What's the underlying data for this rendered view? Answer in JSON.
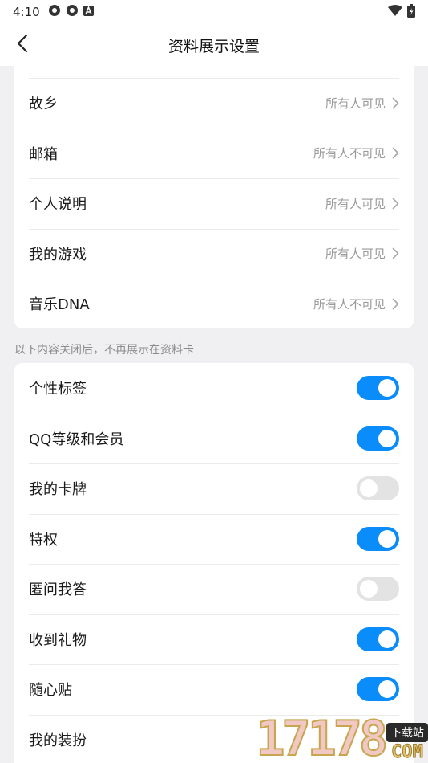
{
  "status_bar": {
    "time": "4:10",
    "icons_left": [
      "settings-gear-icon",
      "settings-gear-icon",
      "a-badge-icon"
    ],
    "icons_right": [
      "wifi-icon",
      "battery-icon"
    ]
  },
  "app_bar": {
    "title": "资料展示设置",
    "back_icon": "chevron-left-icon"
  },
  "visibility_settings": [
    {
      "label": "故乡",
      "value": "所有人可见"
    },
    {
      "label": "邮箱",
      "value": "所有人不可见"
    },
    {
      "label": "个人说明",
      "value": "所有人可见"
    },
    {
      "label": "我的游戏",
      "value": "所有人可见"
    },
    {
      "label": "音乐DNA",
      "value": "所有人不可见"
    }
  ],
  "section_hint": "以下内容关闭后，不再展示在资料卡",
  "toggle_settings": [
    {
      "label": "个性标签",
      "on": true
    },
    {
      "label": "QQ等级和会员",
      "on": true
    },
    {
      "label": "我的卡牌",
      "on": false
    },
    {
      "label": "特权",
      "on": true
    },
    {
      "label": "匿问我答",
      "on": false
    },
    {
      "label": "收到礼物",
      "on": true
    },
    {
      "label": "随心贴",
      "on": true
    },
    {
      "label": "我的装扮",
      "on": false
    }
  ],
  "watermark": {
    "number": "17178",
    "tag": "下载站",
    "suffix": "COM"
  },
  "colors": {
    "accent": "#0a8dfb",
    "toggle_off": "#e3e3e3",
    "background": "#f0f0f3",
    "secondary_text": "#9a9a9a"
  }
}
